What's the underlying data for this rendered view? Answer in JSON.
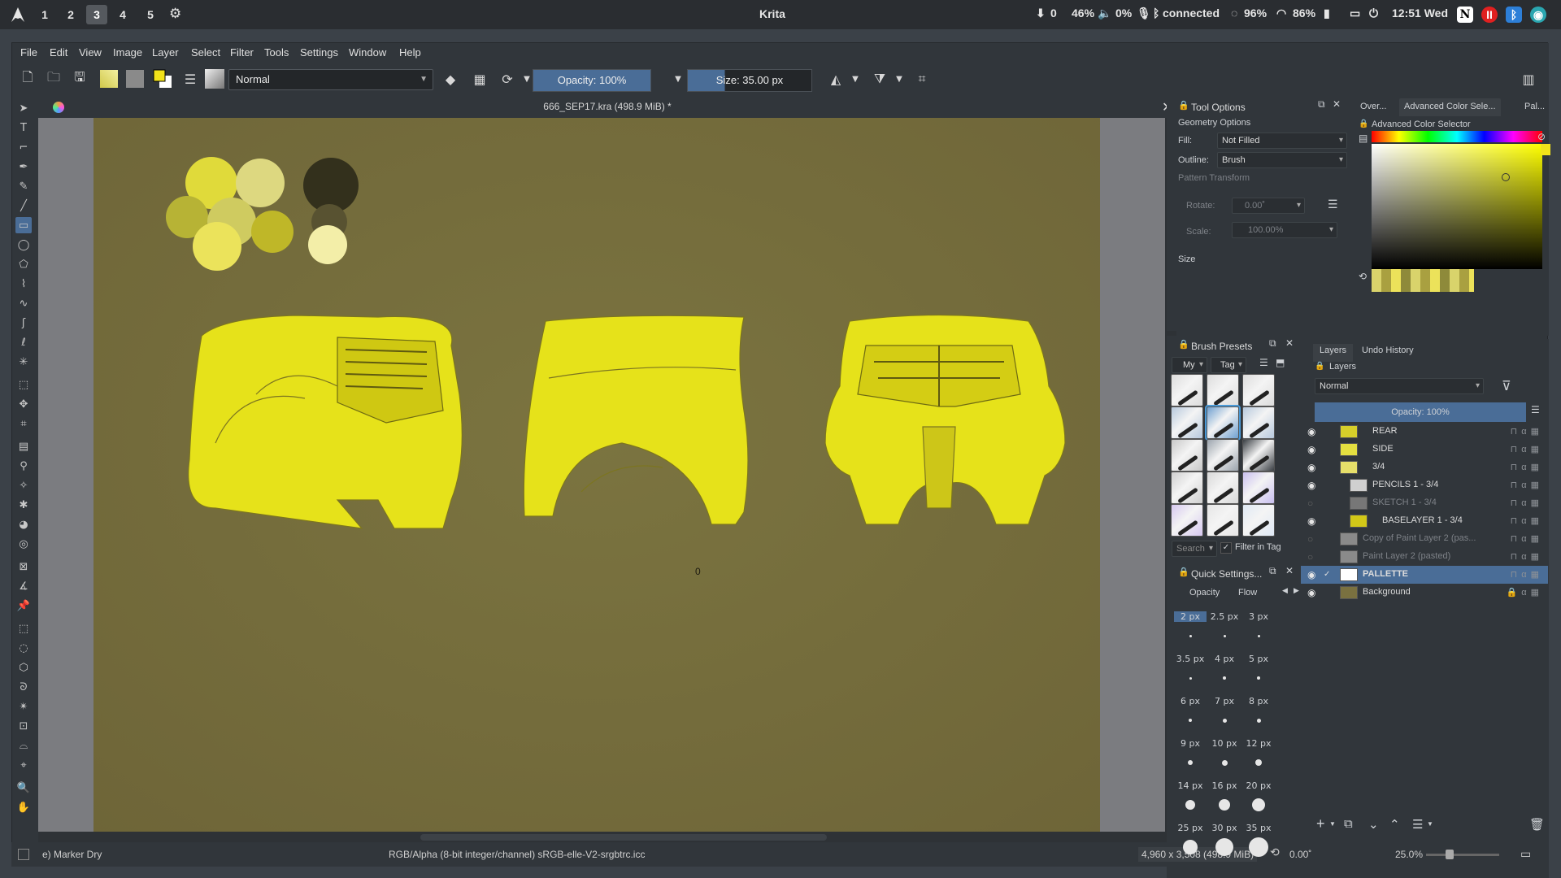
{
  "system_bar": {
    "workspaces": [
      "1",
      "2",
      "3",
      "4",
      "5"
    ],
    "active_workspace": "3",
    "title": "Krita",
    "tray": {
      "updates": "0",
      "brightness": "46%",
      "volume": "0%",
      "bluetooth": "connected",
      "battery_1": "96%",
      "wifi": "86%",
      "clock": "12:51 Wed"
    }
  },
  "menu": [
    "File",
    "Edit",
    "View",
    "Image",
    "Layer",
    "Select",
    "Filter",
    "Tools",
    "Settings",
    "Window",
    "Help"
  ],
  "toolbar": {
    "blend_mode": "Normal",
    "opacity": "Opacity: 100%",
    "size": "Size: 35.00 px"
  },
  "document": {
    "title": "666_SEP17.kra (498.9 MiB) *",
    "canvas_marker": "0"
  },
  "tool_options": {
    "title": "Tool Options",
    "section": "Geometry Options",
    "fill_label": "Fill:",
    "fill_value": "Not Filled",
    "outline_label": "Outline:",
    "outline_value": "Brush",
    "pattern_transform": "Pattern Transform",
    "rotate_label": "Rotate:",
    "rotate_value": "0.00˚",
    "scale_label": "Scale:",
    "scale_value": "100.00%",
    "size_label": "Size"
  },
  "color_docker": {
    "tabs": [
      "Over...",
      "Advanced Color Sele...",
      "Pal..."
    ],
    "title": "Advanced Color Selector",
    "hue_color": "#ffff00"
  },
  "brush_presets": {
    "title": "Brush Presets",
    "filter_label": "My",
    "tag_label": "Tag",
    "search_placeholder": "Search",
    "filter_in_tag": "Filter in Tag"
  },
  "quick_settings": {
    "title": "Quick Settings...",
    "tabs": [
      "Opacity",
      "Flow"
    ],
    "sizes": [
      "2 px",
      "2.5 px",
      "3 px",
      "3.5 px",
      "4 px",
      "5 px",
      "6 px",
      "7 px",
      "8 px",
      "9 px",
      "10 px",
      "12 px",
      "14 px",
      "16 px",
      "20 px",
      "25 px",
      "30 px",
      "35 px"
    ]
  },
  "layers": {
    "tabs": [
      "Layers",
      "Undo History"
    ],
    "title": "Layers",
    "blend_mode": "Normal",
    "opacity": "Opacity:  100%",
    "items": [
      {
        "name": "REAR",
        "visible": true,
        "selected": false,
        "dim": false
      },
      {
        "name": "SIDE",
        "visible": true,
        "selected": false,
        "dim": false
      },
      {
        "name": "3/4",
        "visible": true,
        "selected": false,
        "dim": false
      },
      {
        "name": "PENCILS 1 - 3/4",
        "visible": true,
        "selected": false,
        "dim": false
      },
      {
        "name": "SKETCH 1 - 3/4",
        "visible": false,
        "selected": false,
        "dim": true
      },
      {
        "name": "BASELAYER 1 - 3/4",
        "visible": true,
        "selected": false,
        "dim": false
      },
      {
        "name": "Copy of Paint Layer 2 (pas...",
        "visible": false,
        "selected": false,
        "dim": true
      },
      {
        "name": "Paint Layer 2 (pasted)",
        "visible": false,
        "selected": false,
        "dim": true
      },
      {
        "name": "PALLETTE",
        "visible": true,
        "selected": true,
        "dim": false
      },
      {
        "name": "Background",
        "visible": true,
        "selected": false,
        "dim": false
      }
    ]
  },
  "status": {
    "brush": "e) Marker Dry",
    "color_info": "RGB/Alpha (8-bit integer/channel)  sRGB-elle-V2-srgbtrc.icc",
    "dimensions": "4,960 x 3,508 (498.9 MiB)",
    "rotation": "0.00˚",
    "zoom": "25.0%"
  }
}
